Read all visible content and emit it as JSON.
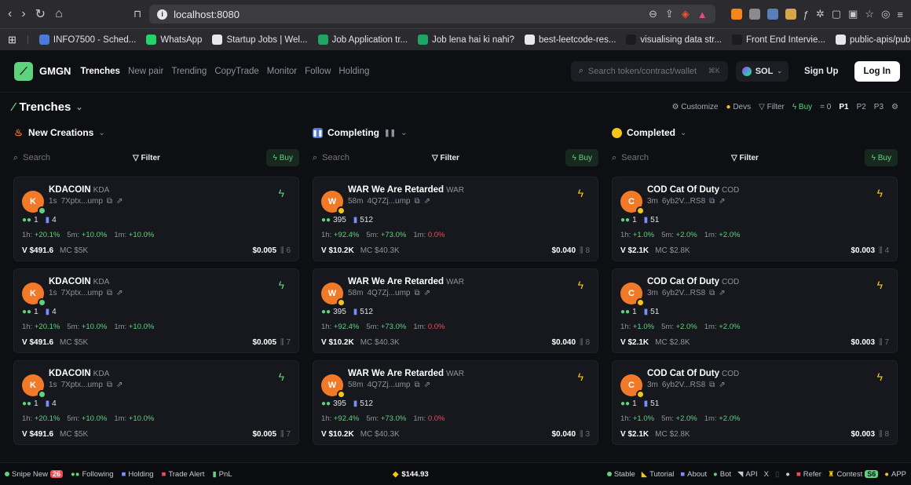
{
  "browser": {
    "url": "localhost:8080",
    "bookmarks": [
      {
        "label": "INFO7500 - Sched...",
        "icon": "calendar-icon",
        "color": "#4a7bd8"
      },
      {
        "label": "WhatsApp",
        "icon": "whatsapp-icon",
        "color": "#25d366"
      },
      {
        "label": "Startup Jobs | Wel...",
        "icon": "wellfound-icon",
        "color": "#e8e8ea"
      },
      {
        "label": "Job Application tr...",
        "icon": "sheets-icon",
        "color": "#1fa463"
      },
      {
        "label": "Job lena hai ki nahi?",
        "icon": "sheets-icon",
        "color": "#1fa463"
      },
      {
        "label": "best-leetcode-res...",
        "icon": "github-icon",
        "color": "#e8e8ea"
      },
      {
        "label": "visualising data str...",
        "icon": "va-icon",
        "color": "#1c1c1c"
      },
      {
        "label": "Front End Intervie...",
        "icon": "code-icon",
        "color": "#1c1c1c"
      },
      {
        "label": "public-apis/public...",
        "icon": "github-icon",
        "color": "#e8e8ea"
      }
    ],
    "more_bookmarks": "»"
  },
  "header": {
    "brand": "GMGN",
    "nav": [
      "Trenches",
      "New pair",
      "Trending",
      "CopyTrade",
      "Monitor",
      "Follow",
      "Holding"
    ],
    "search_placeholder": "Search token/contract/wallet",
    "search_kbd": "⌘K",
    "chain": "SOL",
    "signup": "Sign Up",
    "login": "Log In"
  },
  "trenches": {
    "title": "Trenches",
    "tools": {
      "customize": "Customize",
      "devs": "Devs",
      "filter": "Filter",
      "buy": "Buy",
      "buy_amount": "= 0",
      "pages": [
        "P1",
        "P2",
        "P3"
      ]
    }
  },
  "columns": [
    {
      "title": "New Creations",
      "search": "Search",
      "filter": "Filter",
      "buy": "Buy",
      "cards": [
        {
          "letter": "K",
          "avatar_color": "#f07a28",
          "badge_color": "#5fd27e",
          "name": "KDACOIN",
          "symbol": "KDA",
          "age": "1s",
          "addr": "7Xptx...ump",
          "holders": "1",
          "txs": "4",
          "h1": "+20.1%",
          "m5": "+10.0%",
          "m1": "+10.0%",
          "m1_neg": false,
          "volume": "V $491.6",
          "mc": "MC $5K",
          "price": "$0.005",
          "count": "6"
        },
        {
          "letter": "K",
          "avatar_color": "#f07a28",
          "badge_color": "#5fd27e",
          "name": "KDACOIN",
          "symbol": "KDA",
          "age": "1s",
          "addr": "7Xptx...ump",
          "holders": "1",
          "txs": "4",
          "h1": "+20.1%",
          "m5": "+10.0%",
          "m1": "+10.0%",
          "m1_neg": false,
          "volume": "V $491.6",
          "mc": "MC $5K",
          "price": "$0.005",
          "count": "7"
        },
        {
          "letter": "K",
          "avatar_color": "#f07a28",
          "badge_color": "#5fd27e",
          "name": "KDACOIN",
          "symbol": "KDA",
          "age": "1s",
          "addr": "7Xptx...ump",
          "holders": "1",
          "txs": "4",
          "h1": "+20.1%",
          "m5": "+10.0%",
          "m1": "+10.0%",
          "m1_neg": false,
          "volume": "V $491.6",
          "mc": "MC $5K",
          "price": "$0.005",
          "count": "7"
        }
      ]
    },
    {
      "title": "Completing",
      "search": "Search",
      "filter": "Filter",
      "buy": "Buy",
      "cards": [
        {
          "letter": "W",
          "avatar_color": "#f07a28",
          "badge_color": "#f5c518",
          "name": "WAR We Are Retarded",
          "symbol": "WAR",
          "age": "58m",
          "addr": "4Q7Zj...ump",
          "holders": "395",
          "txs": "512",
          "h1": "+92.4%",
          "m5": "+73.0%",
          "m1": "0.0%",
          "m1_neg": true,
          "volume": "V $10.2K",
          "mc": "MC $40.3K",
          "price": "$0.040",
          "count": "8"
        },
        {
          "letter": "W",
          "avatar_color": "#f07a28",
          "badge_color": "#f5c518",
          "name": "WAR We Are Retarded",
          "symbol": "WAR",
          "age": "58m",
          "addr": "4Q7Zj...ump",
          "holders": "395",
          "txs": "512",
          "h1": "+92.4%",
          "m5": "+73.0%",
          "m1": "0.0%",
          "m1_neg": true,
          "volume": "V $10.2K",
          "mc": "MC $40.3K",
          "price": "$0.040",
          "count": "8"
        },
        {
          "letter": "W",
          "avatar_color": "#f07a28",
          "badge_color": "#f5c518",
          "name": "WAR We Are Retarded",
          "symbol": "WAR",
          "age": "58m",
          "addr": "4Q7Zj...ump",
          "holders": "395",
          "txs": "512",
          "h1": "+92.4%",
          "m5": "+73.0%",
          "m1": "0.0%",
          "m1_neg": true,
          "volume": "V $10.2K",
          "mc": "MC $40.3K",
          "price": "$0.040",
          "count": "3"
        }
      ]
    },
    {
      "title": "Completed",
      "search": "Search",
      "filter": "Filter",
      "buy": "Buy",
      "cards": [
        {
          "letter": "C",
          "avatar_color": "#f07a28",
          "badge_color": "#f5c518",
          "name": "COD Cat Of Duty",
          "symbol": "COD",
          "age": "3m",
          "addr": "6yb2V...RS8",
          "holders": "1",
          "txs": "51",
          "h1": "+1.0%",
          "m5": "+2.0%",
          "m1": "+2.0%",
          "m1_neg": false,
          "volume": "V $2.1K",
          "mc": "MC $2.8K",
          "price": "$0.003",
          "count": "4"
        },
        {
          "letter": "C",
          "avatar_color": "#f07a28",
          "badge_color": "#f5c518",
          "name": "COD Cat Of Duty",
          "symbol": "COD",
          "age": "3m",
          "addr": "6yb2V...RS8",
          "holders": "1",
          "txs": "51",
          "h1": "+1.0%",
          "m5": "+2.0%",
          "m1": "+2.0%",
          "m1_neg": false,
          "volume": "V $2.1K",
          "mc": "MC $2.8K",
          "price": "$0.003",
          "count": "7"
        },
        {
          "letter": "C",
          "avatar_color": "#f07a28",
          "badge_color": "#f5c518",
          "name": "COD Cat Of Duty",
          "symbol": "COD",
          "age": "3m",
          "addr": "6yb2V...RS8",
          "holders": "1",
          "txs": "51",
          "h1": "+1.0%",
          "m5": "+2.0%",
          "m1": "+2.0%",
          "m1_neg": false,
          "volume": "V $2.1K",
          "mc": "MC $2.8K",
          "price": "$0.003",
          "count": "8"
        }
      ]
    }
  ],
  "footer": {
    "snipe": "Snipe New",
    "snipe_count": "26",
    "following": "Following",
    "holding": "Holding",
    "trade_alert": "Trade Alert",
    "pnl": "PnL",
    "sol_price": "$144.93",
    "stable": "Stable",
    "tutorial": "Tutorial",
    "about": "About",
    "bot": "Bot",
    "api": "API",
    "refer": "Refer",
    "contest": "Contest",
    "contest_badge": "S6",
    "app": "APP"
  }
}
